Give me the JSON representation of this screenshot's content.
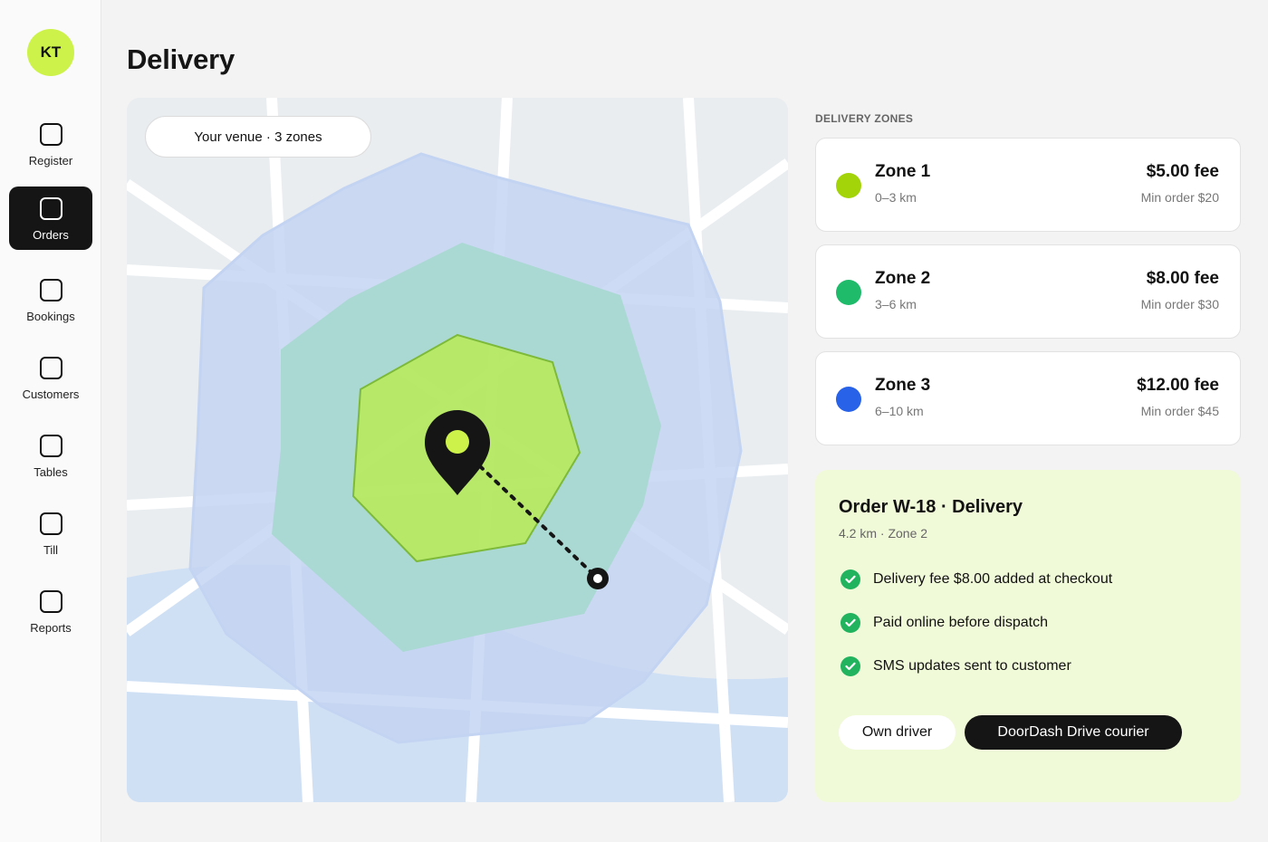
{
  "user": {
    "initials": "KT"
  },
  "nav": {
    "items": [
      {
        "label": "Register",
        "active": false
      },
      {
        "label": "Orders",
        "active": true
      },
      {
        "label": "Bookings",
        "active": false
      },
      {
        "label": "Customers",
        "active": false
      },
      {
        "label": "Tables",
        "active": false
      },
      {
        "label": "Till",
        "active": false
      },
      {
        "label": "Reports",
        "active": false
      }
    ]
  },
  "page": {
    "title": "Delivery"
  },
  "map": {
    "venue_pill": "Your venue · 3 zones",
    "pin_color": "#151515",
    "zone_fill_colors": [
      "#b9ea5c",
      "#a6d8cf",
      "#c3d3f2"
    ]
  },
  "zones": {
    "section_label": "DELIVERY ZONES",
    "items": [
      {
        "name": "Zone 1",
        "range": "0–3 km",
        "fee": "$5.00 fee",
        "min_order": "Min order $20",
        "color": "#a3d40a"
      },
      {
        "name": "Zone 2",
        "range": "3–6 km",
        "fee": "$8.00 fee",
        "min_order": "Min order $30",
        "color": "#1fba6a"
      },
      {
        "name": "Zone 3",
        "range": "6–10 km",
        "fee": "$12.00 fee",
        "min_order": "Min order $45",
        "color": "#2862e8"
      }
    ]
  },
  "order": {
    "title": "Order W-18 · Delivery",
    "subtitle": "4.2 km · Zone 2",
    "checks": [
      "Delivery fee $8.00 added at checkout",
      "Paid online before dispatch",
      "SMS updates sent to customer"
    ],
    "own_driver_label": "Own driver",
    "courier_label": "DoorDash Drive courier"
  }
}
